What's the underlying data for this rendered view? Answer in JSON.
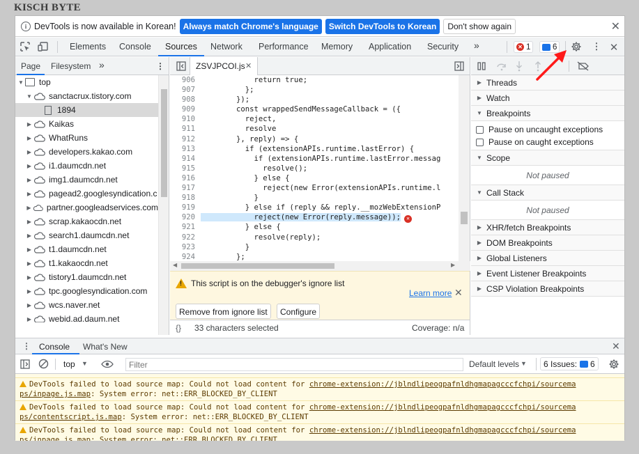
{
  "watermark": "KISCH BYTE",
  "infobar": {
    "message": "DevTools is now available in Korean!",
    "btn_match": "Always match Chrome's language",
    "btn_switch": "Switch DevTools to Korean",
    "btn_dont_show": "Don't show again"
  },
  "main_tabs": [
    "Elements",
    "Console",
    "Sources",
    "Network",
    "Performance",
    "Memory",
    "Application",
    "Security"
  ],
  "active_tab": "Sources",
  "more_tabs": "»",
  "badges": {
    "errors": "1",
    "messages": "6"
  },
  "navigator": {
    "tabs": [
      "Page",
      "Filesystem"
    ],
    "more": "»",
    "tree": [
      {
        "label": "top",
        "type": "frame",
        "level": 0,
        "expanded": true
      },
      {
        "label": "sanctacrux.tistory.com",
        "type": "cloud",
        "level": 1,
        "expanded": true
      },
      {
        "label": "1894",
        "type": "file",
        "level": 2,
        "selected": true
      },
      {
        "label": "Kaikas",
        "type": "cloud",
        "level": 1
      },
      {
        "label": "WhatRuns",
        "type": "cloud",
        "level": 1
      },
      {
        "label": "developers.kakao.com",
        "type": "cloud",
        "level": 1
      },
      {
        "label": "i1.daumcdn.net",
        "type": "cloud",
        "level": 1
      },
      {
        "label": "img1.daumcdn.net",
        "type": "cloud",
        "level": 1
      },
      {
        "label": "pagead2.googlesyndication.c",
        "type": "cloud",
        "level": 1
      },
      {
        "label": "partner.googleadservices.com",
        "type": "cloud",
        "level": 1
      },
      {
        "label": "scrap.kakaocdn.net",
        "type": "cloud",
        "level": 1
      },
      {
        "label": "search1.daumcdn.net",
        "type": "cloud",
        "level": 1
      },
      {
        "label": "t1.daumcdn.net",
        "type": "cloud",
        "level": 1
      },
      {
        "label": "t1.kakaocdn.net",
        "type": "cloud",
        "level": 1
      },
      {
        "label": "tistory1.daumcdn.net",
        "type": "cloud",
        "level": 1
      },
      {
        "label": "tpc.googlesyndication.com",
        "type": "cloud",
        "level": 1
      },
      {
        "label": "wcs.naver.net",
        "type": "cloud",
        "level": 1
      },
      {
        "label": "webid.ad.daum.net",
        "type": "cloud",
        "level": 1
      }
    ]
  },
  "editor": {
    "file_tab": "ZSVJPCOI.js",
    "lines": [
      {
        "n": "906",
        "code": "            return true;"
      },
      {
        "n": "907",
        "code": "          };"
      },
      {
        "n": "908",
        "code": "        });"
      },
      {
        "n": "909",
        "code": "        const wrappedSendMessageCallback = ({"
      },
      {
        "n": "910",
        "code": "          reject,"
      },
      {
        "n": "911",
        "code": "          resolve"
      },
      {
        "n": "912",
        "code": "        }, reply) => {"
      },
      {
        "n": "913",
        "code": "          if (extensionAPIs.runtime.lastError) {"
      },
      {
        "n": "914",
        "code": "            if (extensionAPIs.runtime.lastError.messag"
      },
      {
        "n": "915",
        "code": "              resolve();"
      },
      {
        "n": "916",
        "code": "            } else {"
      },
      {
        "n": "917",
        "code": "              reject(new Error(extensionAPIs.runtime.l"
      },
      {
        "n": "918",
        "code": "            }"
      },
      {
        "n": "919",
        "code": "          } else if (reply && reply.__mozWebExtensionP"
      },
      {
        "n": "920",
        "code": "            reject(new Error(reply.message));",
        "selected": true,
        "error": true
      },
      {
        "n": "921",
        "code": "          } else {"
      },
      {
        "n": "922",
        "code": "            resolve(reply);"
      },
      {
        "n": "923",
        "code": "          }"
      },
      {
        "n": "924",
        "code": "        };"
      }
    ],
    "ignore_message": "This script is on the debugger's ignore list",
    "learn_more": "Learn more",
    "btn_remove": "Remove from ignore list",
    "btn_configure": "Configure",
    "status_selection": "33 characters selected",
    "status_coverage": "Coverage: n/a"
  },
  "debugger": {
    "threads": "Threads",
    "watch": "Watch",
    "breakpoints": "Breakpoints",
    "pause_uncaught": "Pause on uncaught exceptions",
    "pause_caught": "Pause on caught exceptions",
    "scope": "Scope",
    "not_paused_1": "Not paused",
    "call_stack": "Call Stack",
    "not_paused_2": "Not paused",
    "xhr": "XHR/fetch Breakpoints",
    "dom": "DOM Breakpoints",
    "global": "Global Listeners",
    "event": "Event Listener Breakpoints",
    "csp": "CSP Violation Breakpoints"
  },
  "drawer": {
    "tab_console": "Console",
    "tab_whats_new": "What's New"
  },
  "console_toolbar": {
    "context": "top",
    "filter_placeholder": "Filter",
    "levels": "Default levels",
    "issues": "6 Issues:",
    "issues_count": "6"
  },
  "console_messages": [
    {
      "prefix": "DevTools failed to load source map: Could not load content for ",
      "link": "chrome-extension://jblndlipeogpafnldhgmapagcccfchpi/sourcema",
      "link2": "ps/inpage.js.map",
      "suffix": ": System error: net::ERR_BLOCKED_BY_CLIENT"
    },
    {
      "prefix": "DevTools failed to load source map: Could not load content for ",
      "link": "chrome-extension://jblndlipeogpafnldhgmapagcccfchpi/sourcema",
      "link2": "ps/contentscript.js.map",
      "suffix": ": System error: net::ERR_BLOCKED_BY_CLIENT"
    },
    {
      "prefix": "DevTools failed to load source map: Could not load content for ",
      "link": "chrome-extension://jblndlipeogpafnldhgmapagcccfchpi/sourcema",
      "link2": "ps/inpage.js.map",
      "suffix": ": System error: net::ERR_BLOCKED_BY_CLIENT"
    }
  ],
  "colors": {
    "accent": "#1a73e8",
    "error": "#d93025",
    "warning_bg": "#fffbe5",
    "annotation_arrow": "#ff1a1a"
  },
  "icons": [
    "info-icon",
    "inspect-icon",
    "device-toggle-icon",
    "settings-gear-icon",
    "kebab-menu-icon",
    "close-icon",
    "cloud-icon",
    "folder-icon",
    "file-icon",
    "pause-icon",
    "step-over-icon",
    "step-into-icon",
    "step-out-icon",
    "deactivate-breakpoints-icon",
    "warning-icon",
    "clear-console-icon",
    "eye-icon"
  ]
}
